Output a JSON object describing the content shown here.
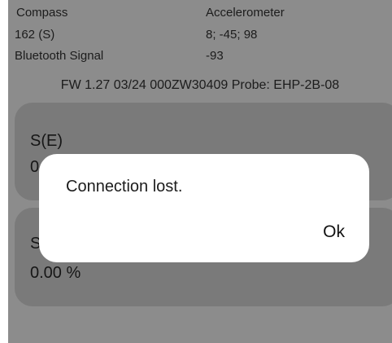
{
  "info": {
    "compass_label": "Compass",
    "compass_value": "162 (S)",
    "accelerometer_label": "Accelerometer",
    "accelerometer_value": "8; -45; 98",
    "bluetooth_label": "Bluetooth Signal",
    "bluetooth_value": "-93"
  },
  "firmware_line": "FW 1.27 03/24 000ZW30409 Probe: EHP-2B-08",
  "cards": [
    {
      "label": "S(E)",
      "value": "0"
    },
    {
      "label": "S",
      "value": "0.00 %"
    }
  ],
  "dialog": {
    "message": "Connection lost.",
    "ok_label": "Ok"
  },
  "colors": {
    "overlay": "#8c8c8c",
    "card": "#7a7a7a",
    "dialog": "#ffffff"
  }
}
